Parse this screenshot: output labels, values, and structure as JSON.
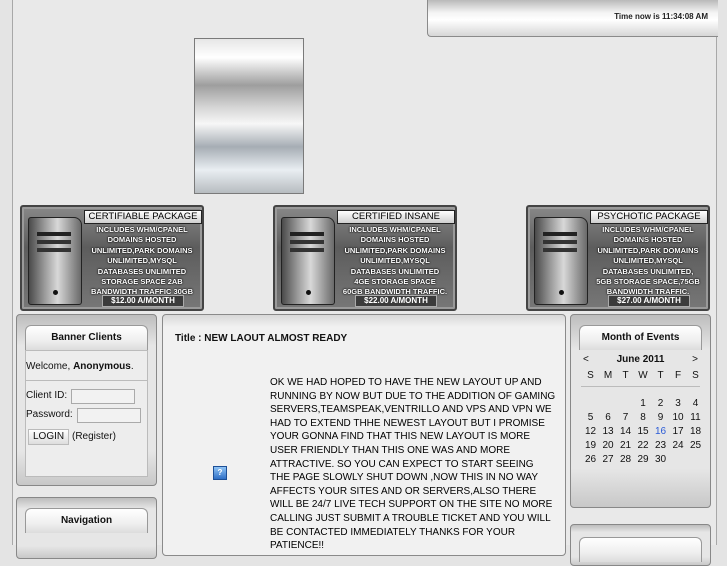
{
  "header": {
    "time_text": "Time now is 11:34:08 AM"
  },
  "packages": [
    {
      "title": "CERTIFIABLE PACKAGE",
      "lines": [
        "INCLUDES WHM/CPANEL",
        "DOMAINS HOSTED",
        "UNLIMITED,PARK DOMAINS",
        "UNLIMITED,MYSQL",
        "DATABASES UNLIMITED",
        "STORAGE SPACE 2AB",
        "BANDWIDTH  TRAFFIC 30GB"
      ],
      "price": "$12.00 A/MONTH"
    },
    {
      "title": "CERTIFIED INSANE",
      "lines": [
        "INCLUDES WHM/CPANEL",
        "DOMAINS HOSTED",
        "UNLIMITED,PARK DOMAINS",
        "UNLIMITED,MYSQL",
        "DATABASES UNLIMITED",
        "4GE STORAGE SPACE",
        "60GB BANDWIDTH TRAFFIC."
      ],
      "price": "$22.00 A/MONTH"
    },
    {
      "title": "PSYCHOTIC PACKAGE",
      "lines": [
        "INCLUDES WHM/CPANEL",
        "DOMAINS HOSTED",
        "UNLIMITED,PARK DOMAINS",
        "UNLIMITED,MYSQL",
        "DATABASES UNLIMITED,",
        "5GB STORAGE SPACE,75GB",
        "BANDWIDTH TRAFFIC."
      ],
      "price": "$27.00 A/MONTH"
    }
  ],
  "banner_clients": {
    "title": "Banner Clients",
    "welcome_prefix": "Welcome, ",
    "welcome_user": "Anonymous",
    "welcome_suffix": ".",
    "client_id_label": "Client ID:",
    "password_label": "Password:",
    "login_button": "LOGIN",
    "register_link": "(Register)"
  },
  "navigation": {
    "title": "Navigation"
  },
  "main": {
    "title": "Title : NEW LAOUT ALMOST READY",
    "icon_glyph": "?",
    "body": "OK WE HAD HOPED TO HAVE THE NEW LAYOUT UP AND RUNNING BY NOW BUT DUE TO THE ADDITION OF GAMING SERVERS,TEAMSPEAK,VENTRILLO AND VPS AND VPN WE HAD TO EXTEND THHE NEWEST LAYOUT BUT I PROMISE YOUR GONNA FIND THAT THIS NEW LAYOUT IS MORE USER FRIENDLY THAN THIS ONE WAS AND MORE ATTRACTIVE. SO YOU CAN EXPECT TO START SEEING THE PAGE SLOWLY SHUT DOWN ,NOW THIS IN NO WAY AFFECTS YOUR SITES AND OR SERVERS,ALSO THERE WILL BE 24/7 LIVE TECH SUPPORT ON THE SITE NO MORE CALLING JUST SUBMIT A TROUBLE TICKET AND YOU WILL BE CONTACTED IMMEDIATELY THANKS FOR YOUR PATIENCE!!"
  },
  "calendar": {
    "title": "Month of Events",
    "prev": "<",
    "next": ">",
    "month_label": "June 2011",
    "weekdays": [
      "S",
      "M",
      "T",
      "W",
      "T",
      "F",
      "S"
    ],
    "weeks": [
      [
        "",
        "",
        "",
        "1",
        "2",
        "3",
        "4"
      ],
      [
        "5",
        "6",
        "7",
        "8",
        "9",
        "10",
        "11"
      ],
      [
        "12",
        "13",
        "14",
        "15",
        "16",
        "17",
        "18"
      ],
      [
        "19",
        "20",
        "21",
        "22",
        "23",
        "24",
        "25"
      ],
      [
        "26",
        "27",
        "28",
        "29",
        "30",
        "",
        ""
      ]
    ],
    "highlight_day": "16",
    "highlight_color": "#2a5bd7"
  }
}
